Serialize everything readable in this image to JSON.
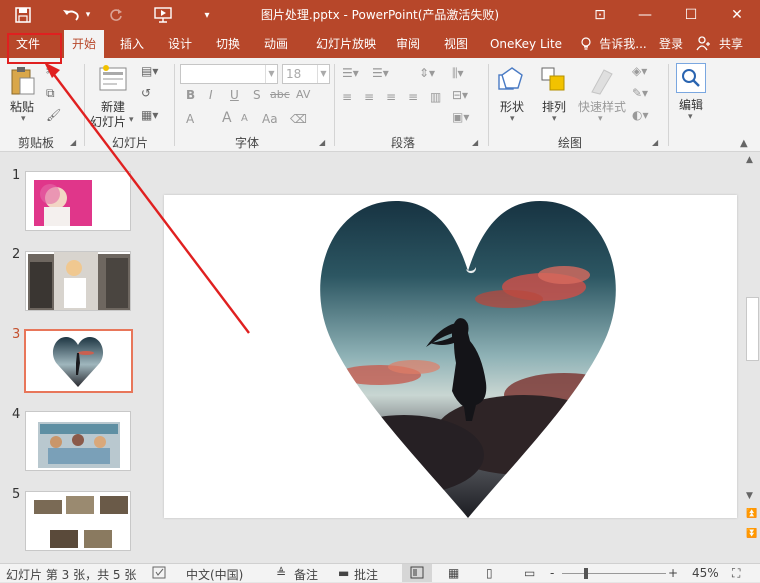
{
  "window": {
    "title": "图片处理.pptx - PowerPoint(产品激活失败)",
    "minimize_glyph": "—",
    "maximize_glyph": "☐",
    "close_glyph": "✕",
    "restore_glyph": "⊡"
  },
  "qat": {
    "save_icon": "save-icon",
    "undo_icon": "undo-icon",
    "redo_icon": "redo-icon",
    "present_icon": "start-from-beginning-icon",
    "more_icon": "customize-toolbar-icon"
  },
  "tabs": [
    {
      "label": "文件"
    },
    {
      "label": "开始"
    },
    {
      "label": "插入"
    },
    {
      "label": "设计"
    },
    {
      "label": "切换"
    },
    {
      "label": "动画"
    },
    {
      "label": "幻灯片放映"
    },
    {
      "label": "审阅"
    },
    {
      "label": "视图"
    },
    {
      "label": "OneKey Lite"
    }
  ],
  "tellme": "告诉我...",
  "signin": "登录",
  "share": "共享",
  "ribbon": {
    "clipboard": {
      "paste": "粘贴",
      "group": "剪贴板"
    },
    "slides": {
      "new_line1": "新建",
      "new_line2": "幻灯片",
      "group": "幻灯片"
    },
    "font": {
      "name_value": "",
      "size_value": "18",
      "group": "字体",
      "bold": "B",
      "italic": "I",
      "underline": "U",
      "shadow": "S",
      "strike": "abc",
      "spacing": "AV",
      "case": "Aa",
      "color": "A",
      "grow": "A",
      "shrink": "A"
    },
    "paragraph": {
      "group": "段落"
    },
    "drawing": {
      "shapes": "形状",
      "arrange": "排列",
      "styles": "快速样式",
      "group": "绘图"
    },
    "editing": {
      "label": "编辑"
    }
  },
  "thumbnails": [
    {
      "num": "1"
    },
    {
      "num": "2"
    },
    {
      "num": "3"
    },
    {
      "num": "4"
    },
    {
      "num": "5"
    }
  ],
  "status": {
    "slide_info": "幻灯片 第 3 张，共 5 张",
    "language": "中文(中国)",
    "notes": "备注",
    "comments": "批注",
    "zoom": "45%",
    "zoom_minus": "-",
    "zoom_plus": "+"
  },
  "colors": {
    "accent": "#b7472a",
    "annotation": "#e02020",
    "selected_thumb": "#e8765a"
  }
}
